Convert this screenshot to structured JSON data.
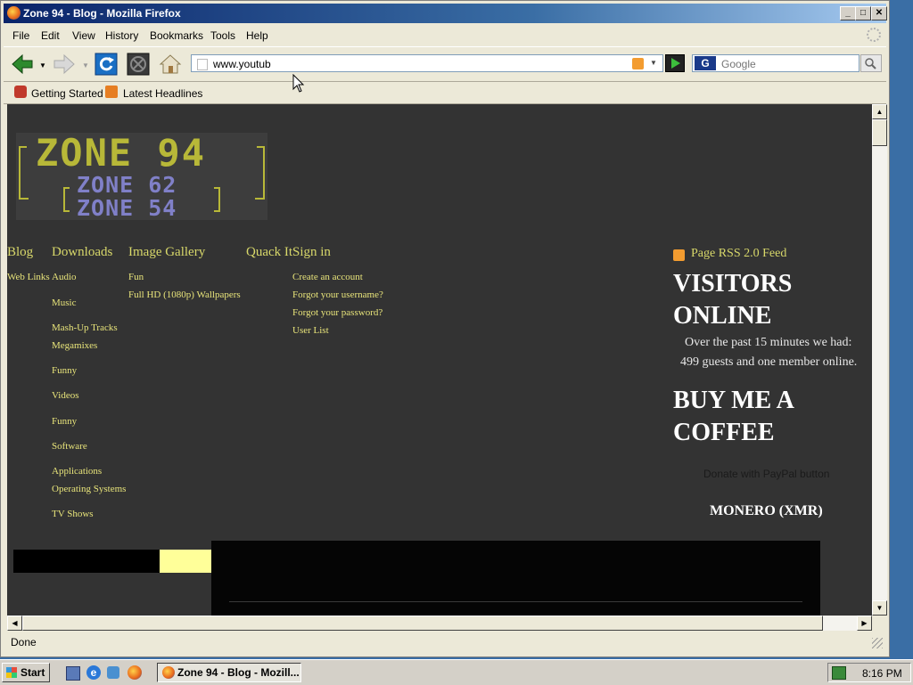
{
  "window": {
    "title": "Zone 94 - Blog - Mozilla Firefox"
  },
  "menu": [
    "File",
    "Edit",
    "View",
    "History",
    "Bookmarks",
    "Tools",
    "Help"
  ],
  "nav": {
    "url": "www.youtub",
    "search_placeholder": "Google"
  },
  "bookmarks": [
    "Getting Started",
    "Latest Headlines"
  ],
  "logo": {
    "line1": "ZONE 94",
    "line2": "ZONE 62",
    "line3": "ZONE 54"
  },
  "site_nav": {
    "blog": "Blog",
    "downloads": "Downloads",
    "image_gallery": "Image Gallery",
    "quack_it": "Quack It",
    "sign_in": "Sign in",
    "web_links": "Web Links",
    "downloads_items": [
      "Audio",
      "Music",
      "Mash-Up Tracks",
      "Megamixes",
      "Funny",
      "Videos",
      "Funny",
      "Software",
      "Applications",
      "Operating Systems",
      "TV Shows"
    ],
    "gallery_items": [
      "Fun",
      "Full HD (1080p) Wallpapers"
    ],
    "signin_items": [
      "Create an account",
      "Forgot your username?",
      "Forgot your password?",
      "User List"
    ]
  },
  "sidebar": {
    "rss": "Page RSS 2.0 Feed",
    "visitors_heading_1": "VISITORS",
    "visitors_heading_2": "ONLINE",
    "visitors_text_1": "Over the past 15 minutes we had:",
    "visitors_text_2": "499 guests and one member online.",
    "coffee_heading_1": "BUY ME A",
    "coffee_heading_2": "COFFEE",
    "donate": "Donate with PayPal button",
    "monero": "MONERO (XMR)"
  },
  "status": "Done",
  "taskbar": {
    "start": "Start",
    "task": "Zone 94 - Blog - Mozill...",
    "clock": "8:16 PM"
  }
}
